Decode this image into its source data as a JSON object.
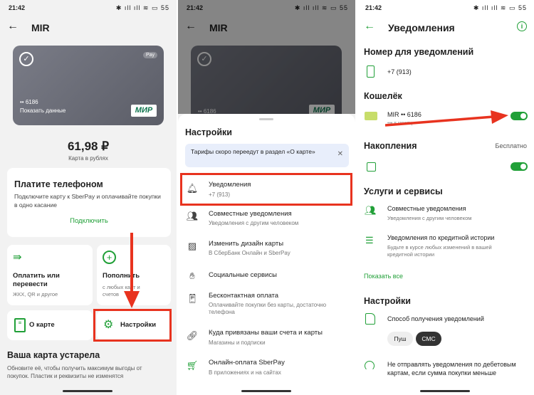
{
  "status_bar": {
    "time": "21:42",
    "icons": "✱ ıll ıll ≋ ▭ 55"
  },
  "screen1": {
    "title": "MIR",
    "card": {
      "number": "•• 6186",
      "show_data": "Показать данные",
      "pay_badge": "Pay",
      "brand": "МИР"
    },
    "balance": "61,98 ₽",
    "balance_caption": "Карта в рублях",
    "promo": {
      "title": "Платите телефоном",
      "text": "Подключите карту к SberPay и оплачивайте покупки в одно касание",
      "link": "Подключить"
    },
    "tiles": [
      {
        "label": "Оплатить или перевести",
        "sub": "ЖКХ, QR и другое"
      },
      {
        "label": "Пополнить",
        "sub": "с любых карт и счетов"
      }
    ],
    "about_card": "О карте",
    "settings": "Настройки",
    "outdated_title": "Ваша карта устарела",
    "outdated_text": "Обновите её, чтобы получить максимум выгоды от покупок. Пластик и реквизиты не изменятся"
  },
  "screen2": {
    "title": "MIR",
    "card_number": "•• 6186",
    "sheet_title": "Настройки",
    "info_banner": "Тарифы скоро переедут в раздел «О карте»",
    "items": [
      {
        "title": "Уведомления",
        "sub": "+7 (913)",
        "icon": "bell-icon"
      },
      {
        "title": "Совместные уведомления",
        "sub": "Уведомления с другим человеком",
        "icon": "people-icon"
      },
      {
        "title": "Изменить дизайн карты",
        "sub": "В СберБанк Онлайн и SberPay",
        "icon": "image-icon"
      },
      {
        "title": "Социальные сервисы",
        "sub": "",
        "icon": "handshake-icon"
      },
      {
        "title": "Бесконтактная оплата",
        "sub": "Оплачивайте покупки без карты, достаточно телефона",
        "icon": "contactless-icon"
      },
      {
        "title": "Куда привязаны ваши счета и карты",
        "sub": "Магазины и подписки",
        "icon": "link-icon"
      },
      {
        "title": "Онлайн-оплата SberPay",
        "sub": "В приложениях и на сайтах",
        "icon": "cart-icon"
      }
    ]
  },
  "screen3": {
    "title": "Уведомления",
    "number_section": "Номер для уведомлений",
    "phone": "+7 (913)",
    "wallet_section": "Кошелёк",
    "wallet_card": "MIR •• 6186",
    "wallet_sub": "••• в месяц",
    "savings_section": "Накопления",
    "savings_price": "Бесплатно",
    "services_section": "Услуги и сервисы",
    "joint_notifications": "Совместные уведомления",
    "joint_sub": "Уведомления с другим человеком",
    "credit_history": "Уведомления по кредитной истории",
    "credit_sub": "Будьте в курсе любых изменений в вашей кредитной истории",
    "show_all": "Показать все",
    "settings_section": "Настройки",
    "method_label": "Способ получения уведомлений",
    "method_options": [
      "Пуш",
      "СМС"
    ],
    "method_selected": "СМС",
    "debit_text": "Не отправлять уведомления по дебетовым картам, если сумма покупки меньше",
    "wallet_toggle_on": true,
    "savings_toggle_on": true
  },
  "colors": {
    "accent": "#21a038",
    "highlight": "#e8331f"
  }
}
